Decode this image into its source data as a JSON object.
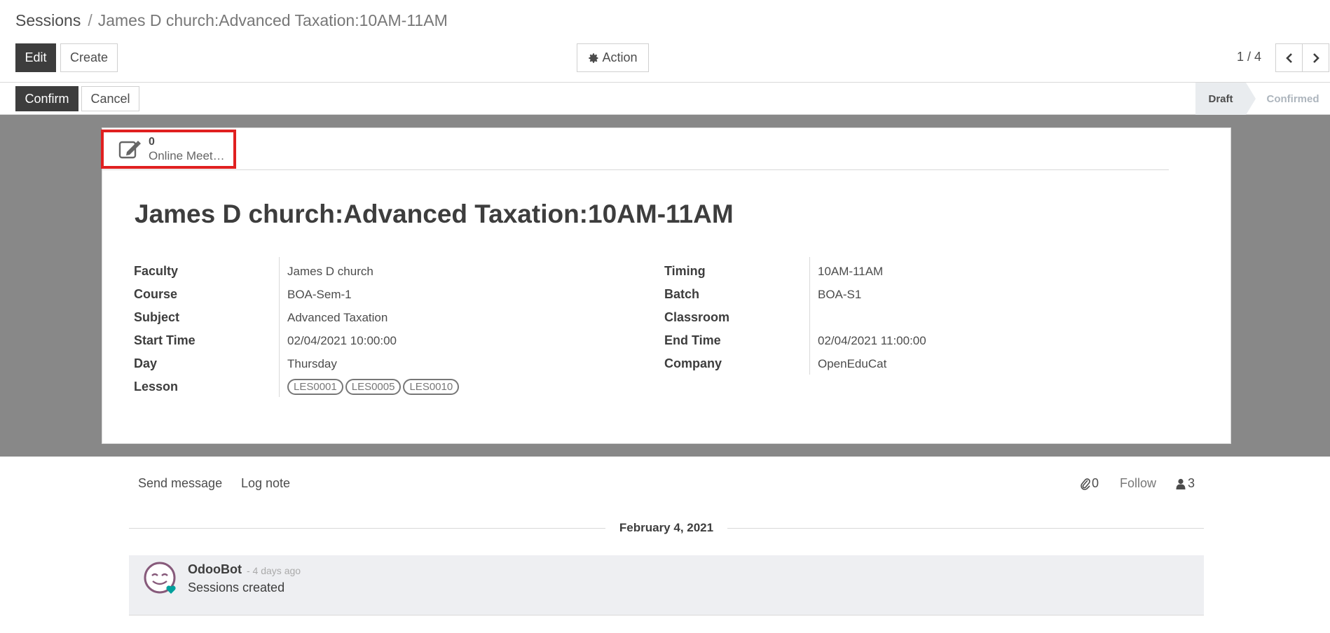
{
  "breadcrumb": {
    "root": "Sessions",
    "separator": "/",
    "current": "James D church:Advanced Taxation:10AM-11AM"
  },
  "toolbar": {
    "edit_label": "Edit",
    "create_label": "Create",
    "action_label": "Action",
    "action_icon": "gear-icon",
    "pager_value": "1 / 4"
  },
  "statusbar": {
    "confirm_label": "Confirm",
    "cancel_label": "Cancel",
    "stages": [
      "Draft",
      "Confirmed"
    ],
    "active_stage": "Draft"
  },
  "smart_button": {
    "value": "0",
    "label": "Online Meet…",
    "icon": "edit-icon"
  },
  "record": {
    "title": "James D church:Advanced Taxation:10AM-11AM",
    "left_fields": [
      {
        "label": "Faculty",
        "value": "James D church"
      },
      {
        "label": "Course",
        "value": "BOA-Sem-1"
      },
      {
        "label": "Subject",
        "value": "Advanced Taxation"
      },
      {
        "label": "Start Time",
        "value": "02/04/2021 10:00:00"
      },
      {
        "label": "Day",
        "value": "Thursday"
      },
      {
        "label": "Lesson",
        "value": ""
      }
    ],
    "lesson_tags": [
      "LES0001",
      "LES0005",
      "LES0010"
    ],
    "right_fields": [
      {
        "label": "Timing",
        "value": "10AM-11AM"
      },
      {
        "label": "Batch",
        "value": "BOA-S1"
      },
      {
        "label": "Classroom",
        "value": ""
      },
      {
        "label": "End Time",
        "value": "02/04/2021 11:00:00"
      },
      {
        "label": "Company",
        "value": "OpenEduCat"
      }
    ]
  },
  "chatter": {
    "send_message_label": "Send message",
    "log_note_label": "Log note",
    "attachments_count": "0",
    "follow_label": "Follow",
    "followers_count": "3",
    "date_separator": "February 4, 2021",
    "messages": [
      {
        "author": "OdooBot",
        "date": "- 4 days ago",
        "body": "Sessions created"
      }
    ]
  },
  "colors": {
    "primary_button": "#3d3d3d",
    "highlight_border": "#e02020",
    "sheet_background": "#888888",
    "avatar_accent": "#875a7b",
    "heart": "#00a09d"
  }
}
